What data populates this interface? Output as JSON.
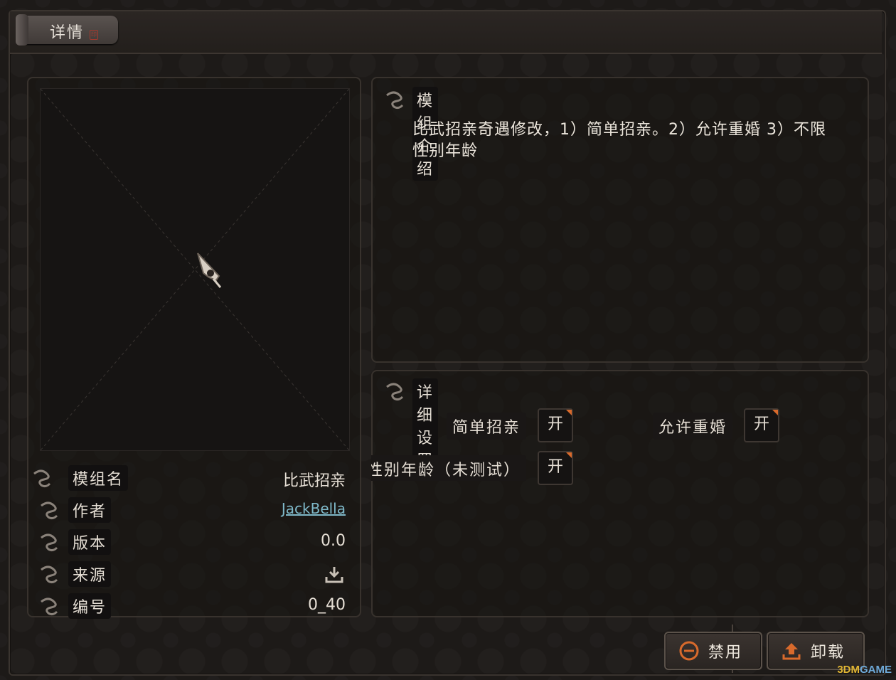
{
  "window": {
    "title": "详情"
  },
  "preview": {
    "image_alt": "preview-placeholder"
  },
  "info": {
    "rows": [
      {
        "label": "模组名",
        "value": "比武招亲",
        "type": "text"
      },
      {
        "label": "作者",
        "value": "JackBella",
        "type": "link"
      },
      {
        "label": "版本",
        "value": "0.0",
        "type": "text"
      },
      {
        "label": "来源",
        "value": "",
        "type": "icon",
        "icon": "download-icon"
      },
      {
        "label": "编号",
        "value": "0_40",
        "type": "text"
      }
    ]
  },
  "description": {
    "header": "模组介绍",
    "text": "比武招亲奇遇修改，1）简单招亲。2）允许重婚 3）不限性别年龄"
  },
  "settings": {
    "header": "详细设置",
    "items": [
      {
        "label": "简单招亲",
        "state": "开"
      },
      {
        "label": "允许重婚",
        "state": "开"
      },
      {
        "label": "限性别年龄（未测试）",
        "state": "开"
      }
    ]
  },
  "actions": {
    "disable_label": "禁用",
    "uninstall_label": "卸载"
  },
  "watermark": {
    "prefix": "3DM",
    "suffix": "GAME"
  },
  "colors": {
    "accent": "#d86a2c",
    "link": "#7fb9c9",
    "background": "#1c1917"
  }
}
